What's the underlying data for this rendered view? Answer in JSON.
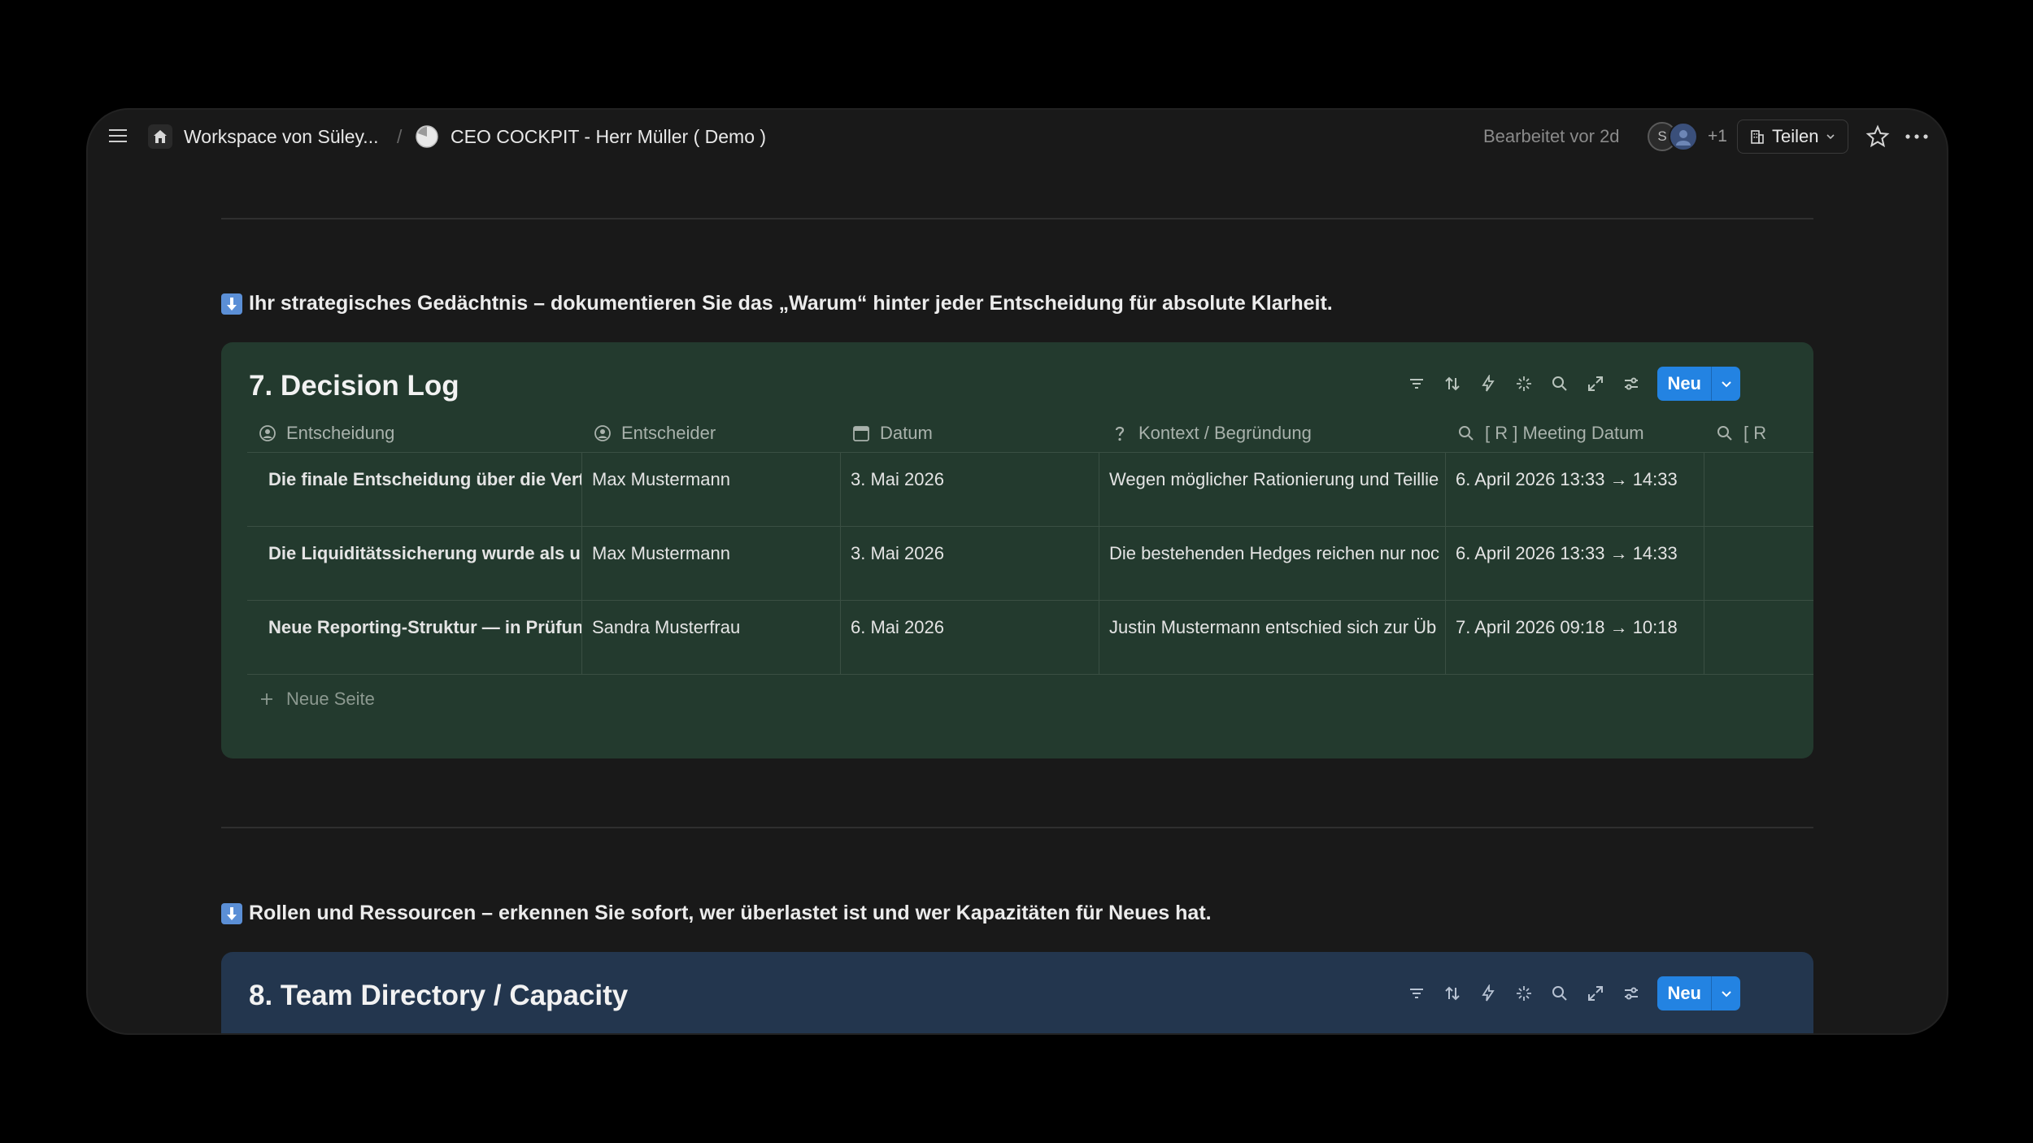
{
  "topbar": {
    "workspace": "Workspace von Süley...",
    "separator": "/",
    "page_title": "CEO COCKPIT - Herr Müller ( Demo )",
    "edited": "Bearbeitet vor 2d",
    "avatar_initial": "S",
    "avatar_more": "+1",
    "share_label": "Teilen"
  },
  "section7": {
    "callout": "Ihr strategisches Gedächtnis – dokumentieren Sie das „Warum“ hinter jeder Entscheidung für absolute Klarheit.",
    "title": "7. Decision Log",
    "new_label": "Neu",
    "columns": [
      "Entscheidung",
      "Entscheider",
      "Datum",
      "Kontext / Begründung",
      "[ R ] Meeting Datum",
      "[ R"
    ],
    "rows": [
      {
        "title": "Die finale Entscheidung über die Vertei",
        "owner": "Max Mustermann",
        "date": "3. Mai 2026",
        "context": "Wegen möglicher Rationierung und Teillie",
        "meeting": "6. April 2026 13:33 → 14:33"
      },
      {
        "title": "Die Liquiditätssicherung wurde als unte",
        "owner": "Max Mustermann",
        "date": "3. Mai 2026",
        "context": "Die bestehenden Hedges reichen nur noc",
        "meeting": "6. April 2026 13:33 → 14:33"
      },
      {
        "title": "Neue Reporting-Struktur — in Prüfung",
        "owner": "Sandra Musterfrau",
        "date": "6. Mai 2026",
        "context": "Justin Mustermann entschied sich zur Üb",
        "meeting": "7. April 2026 09:18 → 10:18"
      }
    ],
    "new_page": "Neue Seite"
  },
  "section8": {
    "callout": "Rollen und Ressourcen – erkennen Sie sofort, wer überlastet ist und wer Kapazitäten für Neues hat.",
    "title": "8. Team Directory / Capacity",
    "new_label": "Neu"
  },
  "colors": {
    "window_bg": "#191919",
    "decision_bg": "#233a2e",
    "team_bg": "#23364e",
    "accent": "#2383e2"
  }
}
